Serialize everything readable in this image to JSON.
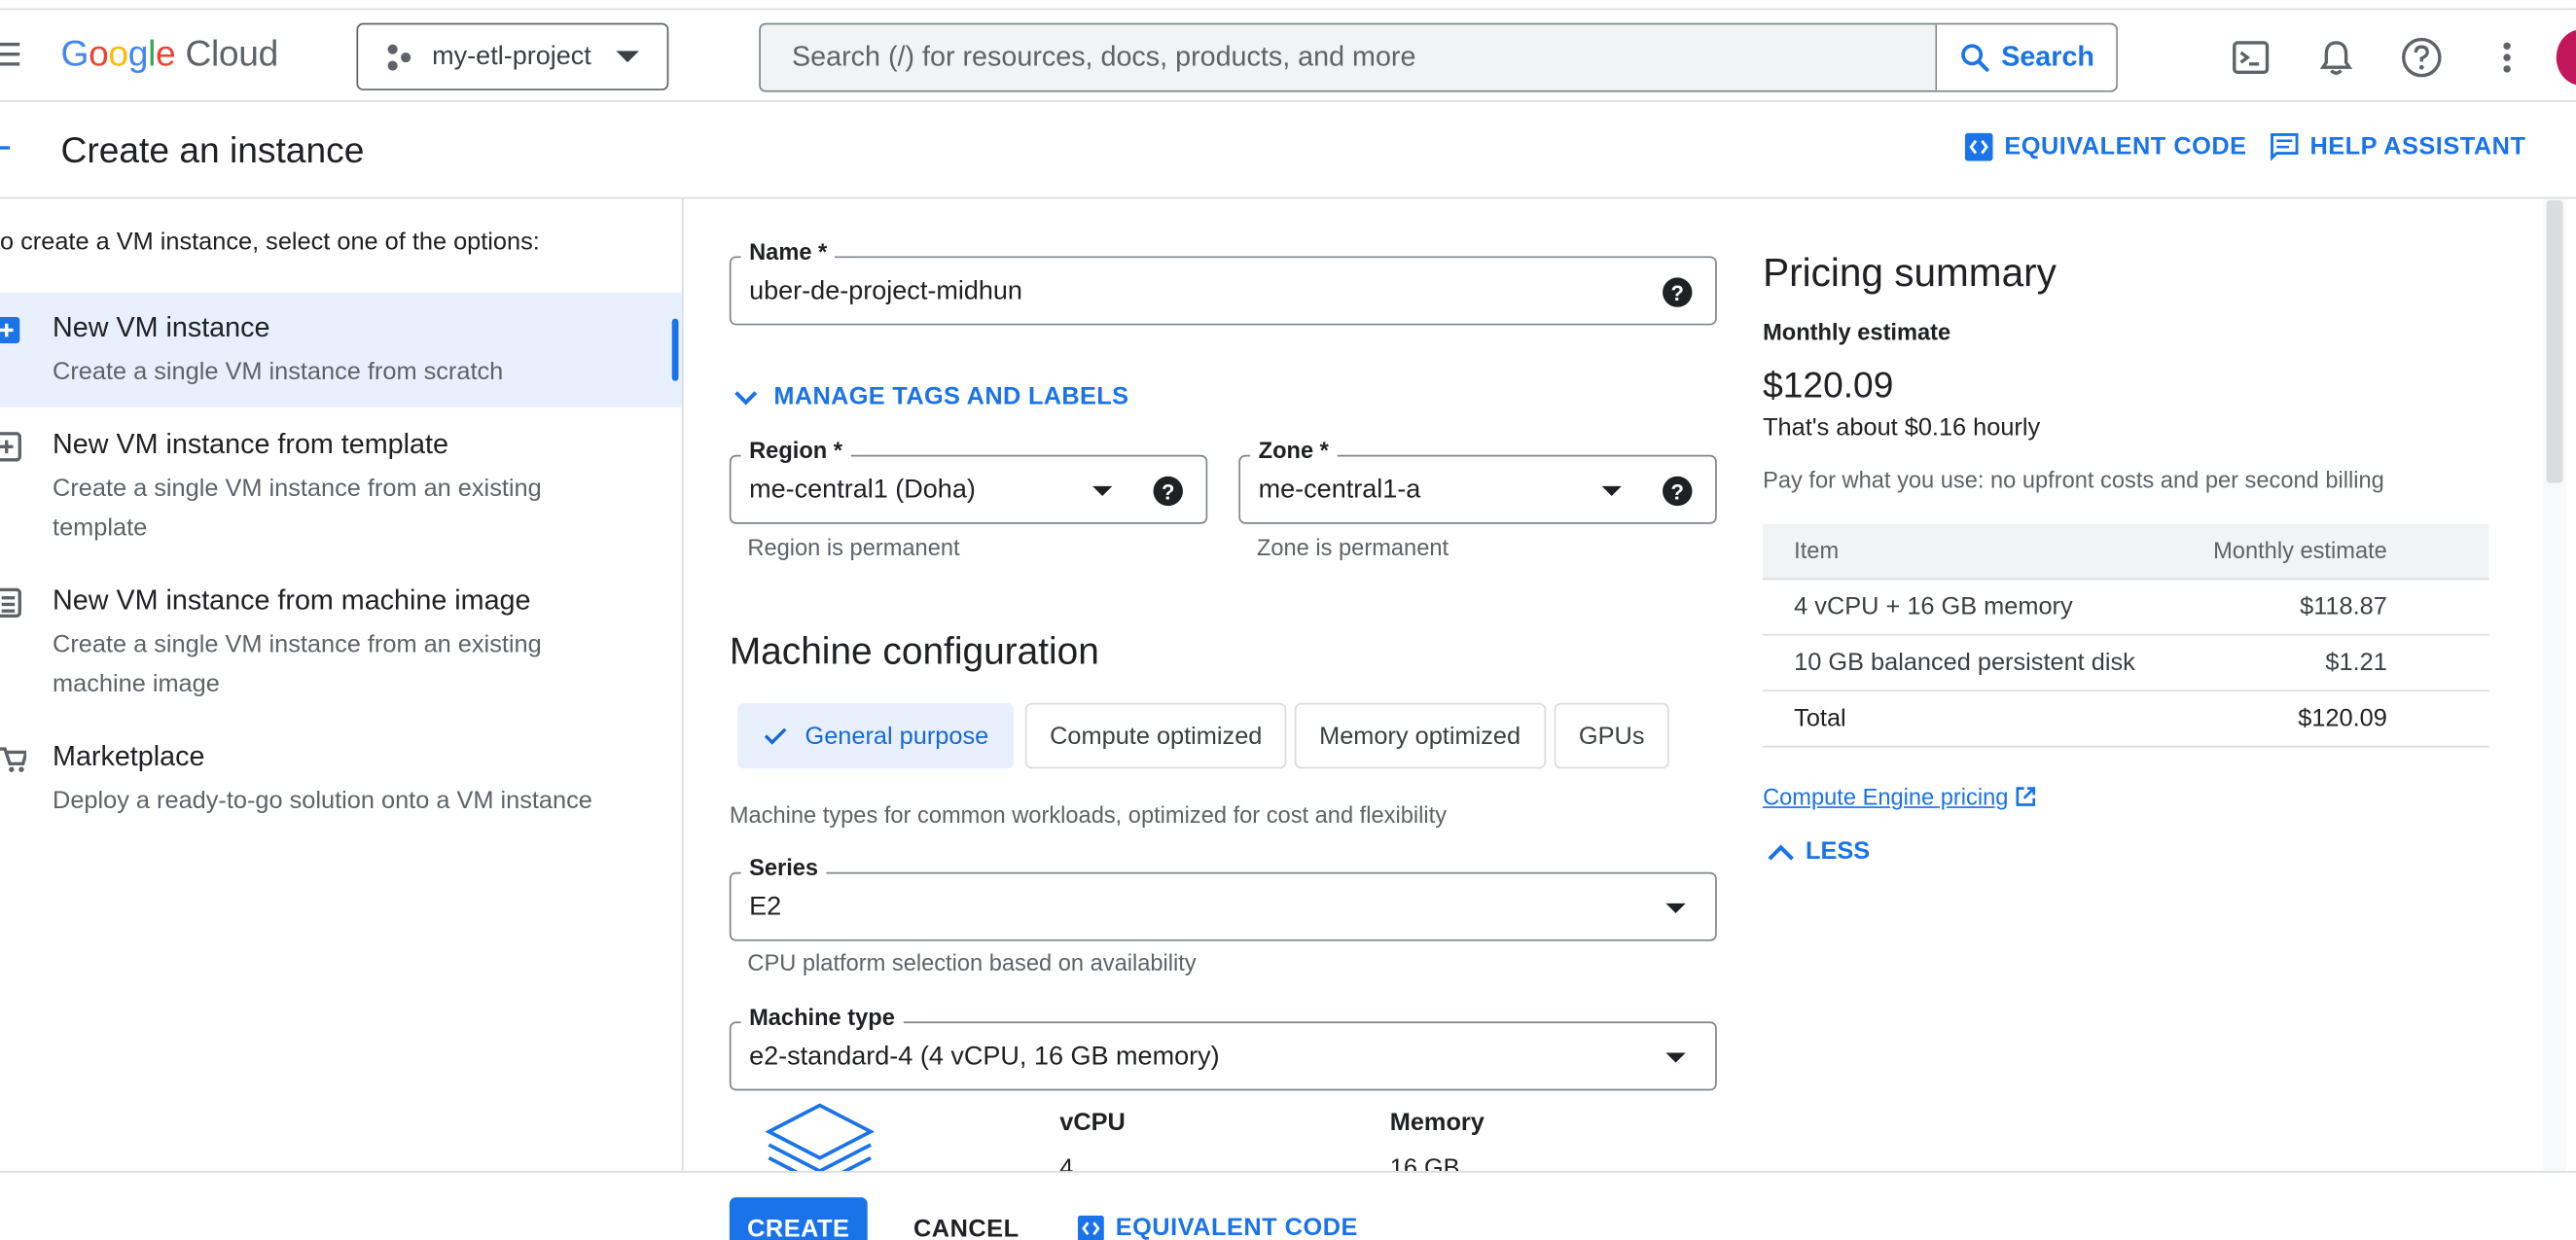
{
  "topbar": {
    "logo_google": "Google",
    "logo_cloud": "Cloud",
    "project": "my-etl-project",
    "search_placeholder": "Search (/) for resources, docs, products, and more",
    "search_label": "Search"
  },
  "header": {
    "title": "Create an instance",
    "equivalent_code": "EQUIVALENT CODE",
    "help_assistant": "HELP ASSISTANT"
  },
  "left": {
    "intro": "o create a VM instance, select one of the options:",
    "options": [
      {
        "title": "New VM instance",
        "desc": "Create a single VM instance from scratch"
      },
      {
        "title": "New VM instance from template",
        "desc": "Create a single VM instance from an existing template"
      },
      {
        "title": "New VM instance from machine image",
        "desc": "Create a single VM instance from an existing machine image"
      },
      {
        "title": "Marketplace",
        "desc": "Deploy a ready-to-go solution onto a VM instance"
      }
    ]
  },
  "form": {
    "name_label": "Name *",
    "name_value": "uber-de-project-midhun",
    "manage_tags": "MANAGE TAGS AND LABELS",
    "region_label": "Region *",
    "region_value": "me-central1 (Doha)",
    "region_hint": "Region is permanent",
    "zone_label": "Zone *",
    "zone_value": "me-central1-a",
    "zone_hint": "Zone is permanent",
    "machine_config_title": "Machine configuration",
    "tabs": [
      "General purpose",
      "Compute optimized",
      "Memory optimized",
      "GPUs"
    ],
    "machine_desc": "Machine types for common workloads, optimized for cost and flexibility",
    "series_label": "Series",
    "series_value": "E2",
    "series_hint": "CPU platform selection based on availability",
    "machine_type_label": "Machine type",
    "machine_type_value": "e2-standard-4 (4 vCPU, 16 GB memory)",
    "vcpu_label": "vCPU",
    "vcpu_value": "4",
    "memory_label": "Memory",
    "memory_value": "16 GB"
  },
  "pricing": {
    "title": "Pricing summary",
    "monthly_label": "Monthly estimate",
    "amount": "$120.09",
    "hourly": "That's about $0.16 hourly",
    "note": "Pay for what you use: no upfront costs and per second billing",
    "col_item": "Item",
    "col_estimate": "Monthly estimate",
    "rows": [
      {
        "item": "4 vCPU + 16 GB memory",
        "cost": "$118.87"
      },
      {
        "item": "10 GB balanced persistent disk",
        "cost": "$1.21"
      },
      {
        "item": "Total",
        "cost": "$120.09"
      }
    ],
    "link": "Compute Engine pricing",
    "less": "LESS"
  },
  "bottom": {
    "create": "CREATE",
    "cancel": "CANCEL",
    "equivalent_code": "EQUIVALENT CODE"
  },
  "colors": {
    "accent": "#1a73e8",
    "selected_bg": "#e8f0fe"
  }
}
